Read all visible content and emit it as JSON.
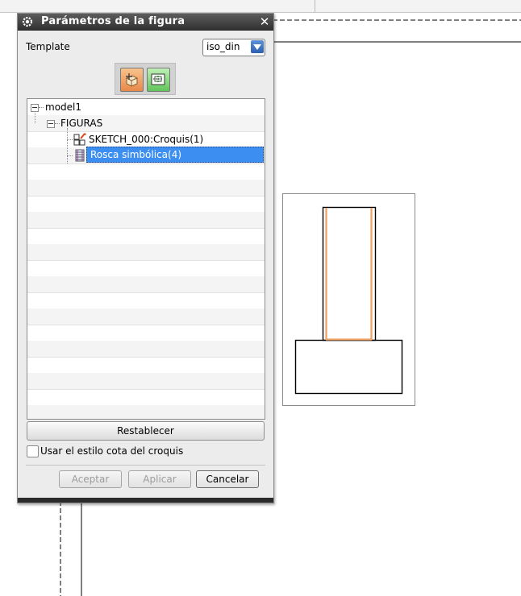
{
  "dialog": {
    "title": "Parámetros de la figura",
    "template_label": "Template",
    "template_value": "iso_din",
    "tree": {
      "root": "model1",
      "group": "FIGURAS",
      "items": [
        {
          "label": "SKETCH_000:Croquis(1)",
          "icon": "sketch-icon"
        },
        {
          "label": "Rosca simbólica(4)",
          "icon": "thread-icon",
          "selected": true
        }
      ]
    },
    "reset_label": "Restablecer",
    "checkbox_label": "Usar el estilo cota del croquis",
    "checkbox_checked": false,
    "buttons": {
      "accept": "Aceptar",
      "apply": "Aplicar",
      "cancel": "Cancelar"
    }
  },
  "colors": {
    "selection": "#3c8ff0",
    "thread_line": "#f0a060",
    "title_bar": "#3a3a3a"
  }
}
